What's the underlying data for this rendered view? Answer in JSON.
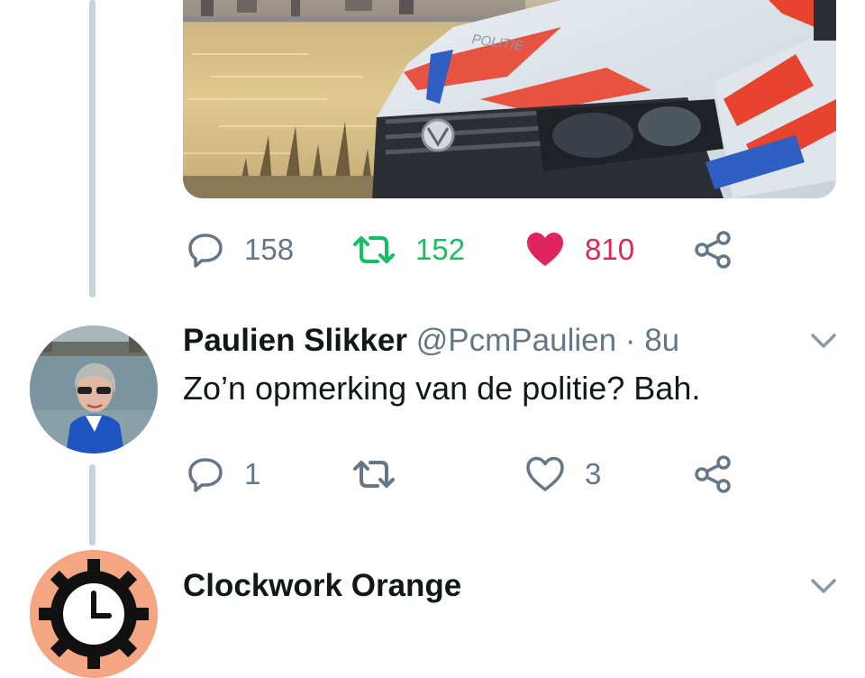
{
  "first_tweet": {
    "media": {
      "vehicle_lettering": "POLITIE"
    },
    "actions": {
      "replies": "158",
      "retweets": "152",
      "likes": "810"
    }
  },
  "reply_tweet": {
    "name": "Paulien Slikker",
    "handle": "@PcmPaulien",
    "separator": "·",
    "time": "8u",
    "text": "Zo’n opmerking van de politie? Bah.",
    "actions": {
      "replies": "1",
      "retweets": "",
      "likes": "3"
    }
  },
  "next_tweet": {
    "name": "Clockwork Orange"
  },
  "colors": {
    "retweet": "#17bf63",
    "like": "#e0245e",
    "icon": "#657786",
    "thread_line": "#c7d3dc"
  },
  "icons": [
    "reply-icon",
    "retweet-icon",
    "like-icon",
    "share-icon",
    "chevron-down-icon",
    "clock-icon"
  ]
}
